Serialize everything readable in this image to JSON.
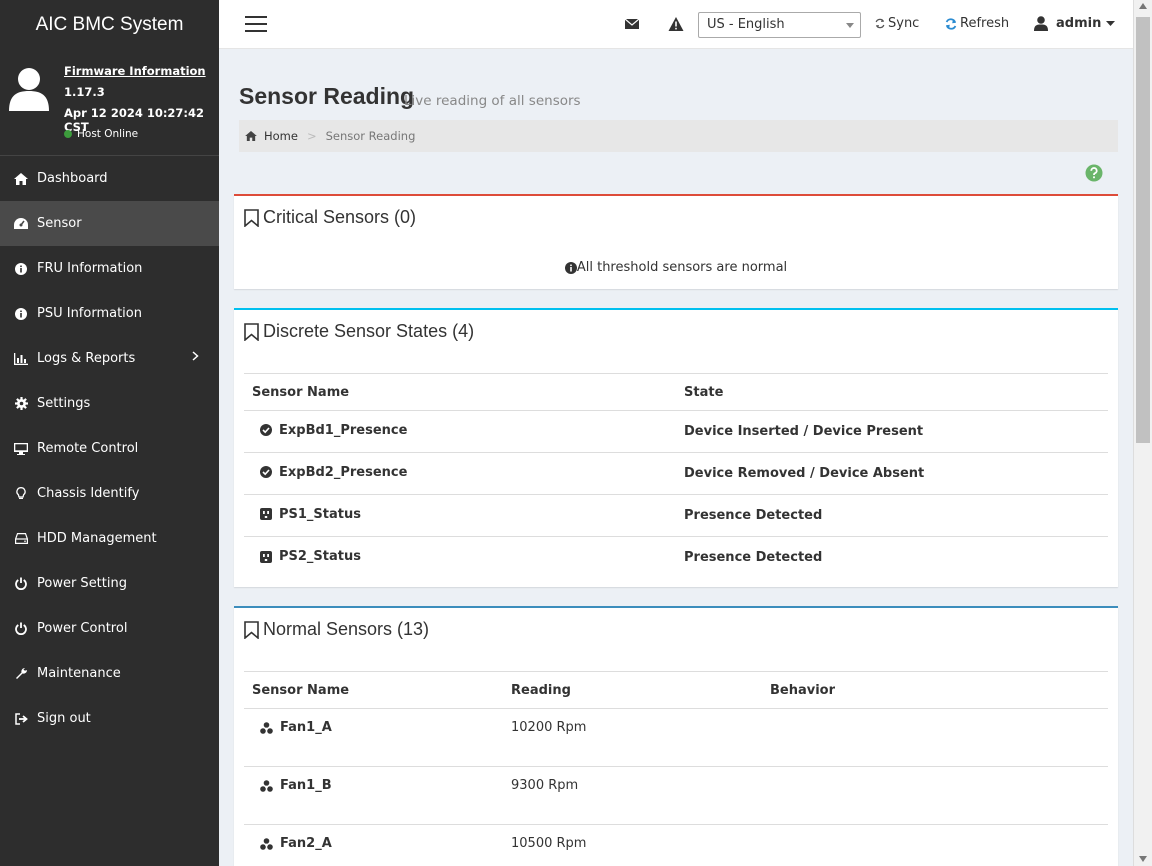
{
  "app": {
    "title": "AIC BMC System"
  },
  "user_panel": {
    "firmware_link": "Firmware Information",
    "version": "1.17.3",
    "build_date": "Apr 12 2024 10:27:42 CST",
    "host_status": "Host Online",
    "host_status_color": "#3c9c3c"
  },
  "sidebar": {
    "items": [
      {
        "label": "Dashboard",
        "icon": "home-icon"
      },
      {
        "label": "Sensor",
        "icon": "gauge-icon",
        "active": true
      },
      {
        "label": "FRU Information",
        "icon": "info-icon"
      },
      {
        "label": "PSU Information",
        "icon": "info-icon"
      },
      {
        "label": "Logs & Reports",
        "icon": "bar-chart-icon",
        "has_submenu": true
      },
      {
        "label": "Settings",
        "icon": "gear-icon"
      },
      {
        "label": "Remote Control",
        "icon": "monitor-icon"
      },
      {
        "label": "Chassis Identify",
        "icon": "lightbulb-icon"
      },
      {
        "label": "HDD Management",
        "icon": "hdd-icon"
      },
      {
        "label": "Power Setting",
        "icon": "power-icon"
      },
      {
        "label": "Power Control",
        "icon": "power-icon"
      },
      {
        "label": "Maintenance",
        "icon": "wrench-icon"
      },
      {
        "label": "Sign out",
        "icon": "sign-out-icon"
      }
    ]
  },
  "header": {
    "language": "US - English",
    "sync_label": "Sync",
    "refresh_label": "Refresh",
    "user_label": "admin"
  },
  "page": {
    "title": "Sensor Reading",
    "subtitle": "Live reading of all sensors",
    "breadcrumb_home": "Home",
    "breadcrumb_sep": ">",
    "breadcrumb_current": "Sensor Reading"
  },
  "critical": {
    "title": "Critical Sensors (0)",
    "message": "All threshold sensors are normal",
    "color": "#dd4b39"
  },
  "discrete": {
    "title": "Discrete Sensor States (4)",
    "color": "#00c0ef",
    "columns": [
      "Sensor Name",
      "State"
    ],
    "rows": [
      {
        "name": "ExpBd1_Presence",
        "state": "Device Inserted / Device Present",
        "icon": "check-circle-icon"
      },
      {
        "name": "ExpBd2_Presence",
        "state": "Device Removed / Device Absent",
        "icon": "check-circle-icon"
      },
      {
        "name": "PS1_Status",
        "state": "Presence Detected",
        "icon": "plug-icon"
      },
      {
        "name": "PS2_Status",
        "state": "Presence Detected",
        "icon": "plug-icon"
      }
    ]
  },
  "normal": {
    "title": "Normal Sensors (13)",
    "color": "#3c8dbc",
    "columns": [
      "Sensor Name",
      "Reading",
      "Behavior"
    ],
    "rows": [
      {
        "name": "Fan1_A",
        "reading": "10200 Rpm",
        "behavior": "",
        "icon": "fan-icon"
      },
      {
        "name": "Fan1_B",
        "reading": "9300 Rpm",
        "behavior": "",
        "icon": "fan-icon"
      },
      {
        "name": "Fan2_A",
        "reading": "10500 Rpm",
        "behavior": "",
        "icon": "fan-icon"
      }
    ]
  }
}
